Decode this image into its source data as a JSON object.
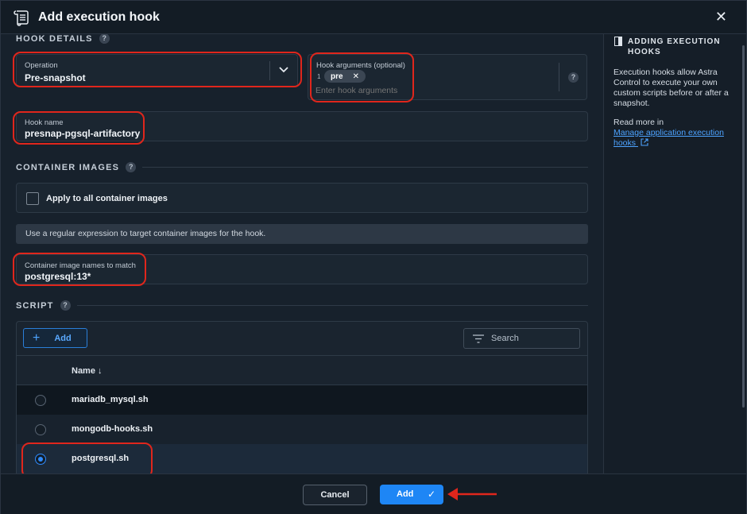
{
  "header": {
    "title": "Add execution hook",
    "close_glyph": "✕"
  },
  "hook_details": {
    "section_title": "HOOK DETAILS",
    "help_glyph": "?",
    "operation": {
      "label": "Operation",
      "value": "Pre-snapshot"
    },
    "arguments": {
      "label": "Hook arguments (optional)",
      "index": "1",
      "chip": "pre",
      "chip_remove": "✕",
      "placeholder": "Enter hook arguments",
      "help_glyph": "?"
    },
    "hook_name": {
      "label": "Hook name",
      "value": "presnap-pgsql-artifactory"
    }
  },
  "container_images": {
    "section_title": "CONTAINER IMAGES",
    "help_glyph": "?",
    "apply_all_label": "Apply to all container images",
    "info": "Use a regular expression to target container images for the hook.",
    "names_to_match": {
      "label": "Container image names to match",
      "value": "postgresql:13*"
    }
  },
  "script": {
    "section_title": "SCRIPT",
    "help_glyph": "?",
    "add_label": "Add",
    "search_placeholder": "Search",
    "column_name": "Name ↓",
    "rows": [
      {
        "name": "mariadb_mysql.sh",
        "selected": false
      },
      {
        "name": "mongodb-hooks.sh",
        "selected": false
      },
      {
        "name": "postgresql.sh",
        "selected": true
      }
    ]
  },
  "side_panel": {
    "title": "ADDING EXECUTION HOOKS",
    "text": "Execution hooks allow Astra Control to execute your own custom scripts before or after a snapshot.",
    "read_more": "Read more in",
    "link": "Manage application execution hooks"
  },
  "footer": {
    "cancel_label": "Cancel",
    "add_label": "Add",
    "add_check": "✓"
  },
  "colors": {
    "accent": "#1e86f5",
    "highlight": "#e0261c",
    "background": "#17212c"
  }
}
